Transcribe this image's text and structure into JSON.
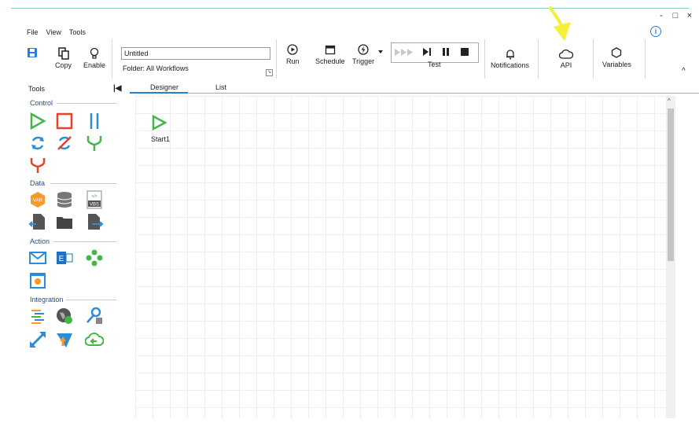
{
  "menu": {
    "file": "File",
    "view": "View",
    "tools": "Tools"
  },
  "window": {
    "minimize": "-",
    "maximize": "□",
    "close": "×"
  },
  "info_icon": "i",
  "ribbon": {
    "save_icon": "save-icon",
    "copy_label": "Copy",
    "enable_label": "Enable",
    "workflow_title": "Untitled",
    "folder_label": "Folder:",
    "folder_value": "All Workflows",
    "run_label": "Run",
    "schedule_label": "Schedule",
    "trigger_label": "Trigger",
    "test_label": "Test",
    "notifications_label": "Notifications",
    "api_label": "API",
    "variables_label": "Variables"
  },
  "toolbox": {
    "title": "Tools",
    "sections": [
      "Control",
      "Data",
      "Action",
      "Integration"
    ]
  },
  "tabs": [
    {
      "label": "Designer"
    },
    {
      "label": "List"
    }
  ],
  "canvas": {
    "start_node": "Start1"
  },
  "colors": {
    "accent": "#2e7bd6",
    "green": "#43b649",
    "red": "#e8402a",
    "arrow": "#f5ef3a"
  }
}
